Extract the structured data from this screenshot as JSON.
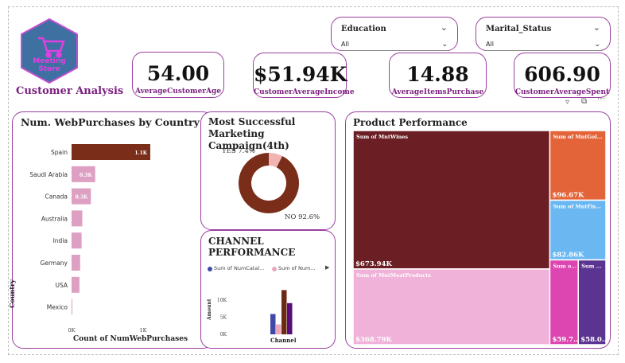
{
  "logo": {
    "text": "Meeting Store"
  },
  "header": {
    "title": "Customer Analysis"
  },
  "kpis": [
    {
      "value": "54.00",
      "label": "AverageCustomerAge"
    },
    {
      "value": "$51.94K",
      "label": "CustomerAverageIncome"
    },
    {
      "value": "14.88",
      "label": "AverageItemsPurchase"
    },
    {
      "value": "606.90",
      "label": "CustomerAverageSpent"
    }
  ],
  "slicers": [
    {
      "title": "Education",
      "value": "All"
    },
    {
      "title": "Marital_Status",
      "value": "All"
    }
  ],
  "visual_header_icons": [
    "filter-icon",
    "focus-mode-icon",
    "more-options-icon"
  ],
  "colors": {
    "accent": "#9b3fa0",
    "brown": "#7a2e1a",
    "pink": "#dda0c2",
    "wine": "#6b1f24",
    "title_purple": "#7a1f7e"
  },
  "chart_data": [
    {
      "type": "bar",
      "title": "Num. WebPurchases by Country",
      "categories": [
        "Spain",
        "Saudi Arabia",
        "Canada",
        "Australia",
        "India",
        "Germany",
        "USA",
        "Mexico"
      ],
      "values": [
        1100,
        330,
        270,
        150,
        140,
        120,
        110,
        5
      ],
      "data_labels": [
        "1.1K",
        "0.3K",
        "0.3K",
        "",
        "",
        "",
        "",
        ""
      ],
      "xlabel": "Count of NumWebPurchases",
      "ylabel": "Country",
      "xticks": [
        "0K",
        "1K"
      ],
      "xlim": [
        0,
        1000
      ]
    },
    {
      "type": "pie",
      "title": "Most Successful Marketing Campaign(4th)",
      "slices": [
        {
          "name": "YES",
          "value": 7.4,
          "label": "YES 7.4%"
        },
        {
          "name": "NO",
          "value": 92.6,
          "label": "NO 92.6%"
        }
      ]
    },
    {
      "type": "bar",
      "title": "CHANNEL PERFORMANCE",
      "legend": [
        "Sum of NumCatal...",
        "Sum of Num..."
      ],
      "categories": [
        "Channel"
      ],
      "series": [
        {
          "name": "Sum of NumCatal...",
          "values": [
            5960
          ]
        },
        {
          "name": "Sum of Num...",
          "values": [
            2900
          ]
        },
        {
          "name": "",
          "values": [
            12970
          ]
        },
        {
          "name": "",
          "values": [
            9150
          ]
        }
      ],
      "xlabel": "Channel",
      "ylabel": "Amount",
      "yticks": [
        "0K",
        "5K",
        "10K"
      ],
      "ylim": [
        0,
        14000
      ]
    },
    {
      "type": "treemap",
      "title": "Product Performance",
      "items": [
        {
          "name": "Sum of MntWines",
          "value": 673.94,
          "label": "$673.94K"
        },
        {
          "name": "Sum of MntMeatProducts",
          "value": 368.79,
          "label": "$368.79K"
        },
        {
          "name": "Sum of MntGol...",
          "value": 96.67,
          "label": "$96.67K"
        },
        {
          "name": "Sum of MntFis...",
          "value": 82.86,
          "label": "$82.86K"
        },
        {
          "name": "Sum o...",
          "value": 59.7,
          "label": "$59.7..."
        },
        {
          "name": "Sum ...",
          "value": 58.0,
          "label": "$58.0..."
        }
      ]
    }
  ]
}
